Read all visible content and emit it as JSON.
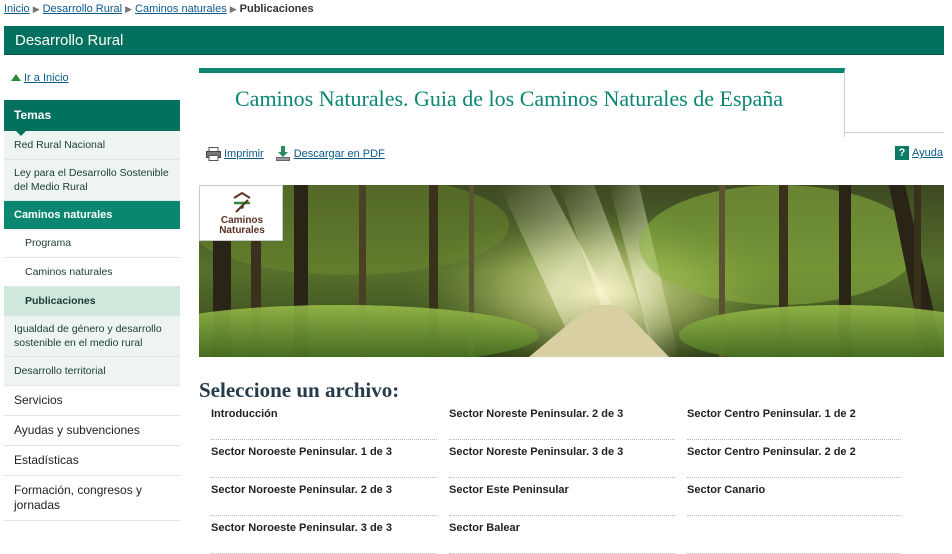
{
  "breadcrumb": {
    "links": [
      "Inicio",
      "Desarrollo Rural",
      "Caminos naturales"
    ],
    "current": "Publicaciones"
  },
  "header": {
    "title": "Desarrollo Rural"
  },
  "home_link": {
    "label": "Ir a Inicio",
    "icon": "up-triangle-icon"
  },
  "sidebar": {
    "heading": "Temas",
    "items": [
      "Red Rural Nacional",
      "Ley para el Desarrollo Sostenible del Medio Rural"
    ],
    "section": "Caminos naturales",
    "sub_items": [
      "Programa",
      "Caminos naturales",
      "Publicaciones"
    ],
    "items_after": [
      "Igualdad de género y desarrollo sostenible en el medio rural",
      "Desarrollo territorial"
    ],
    "main_items": [
      "Servicios",
      "Ayudas y subvenciones",
      "Estadísticas",
      "Formación, congresos y jornadas"
    ]
  },
  "page": {
    "title": "Caminos Naturales. Guia de los Caminos Naturales de España"
  },
  "toolbar": {
    "print_label": "Imprimir",
    "pdf_label": "Descargar en PDF",
    "help_label": "Ayuda",
    "help_glyph": "?"
  },
  "banner": {
    "logo_line1": "Caminos",
    "logo_line2": "Naturales"
  },
  "files": {
    "heading": "Seleccione un archivo:",
    "columns": [
      [
        "Introducción",
        "Sector Noroeste Peninsular. 1 de 3",
        "Sector Noroeste Peninsular. 2 de 3",
        "Sector Noroeste Peninsular. 3 de 3"
      ],
      [
        "Sector Noreste Peninsular. 2 de 3",
        "Sector Noreste Peninsular. 3 de 3",
        "Sector Este Peninsular",
        "Sector Balear"
      ],
      [
        "Sector Centro Peninsular. 1 de 2",
        "Sector Centro Peninsular. 2 de 2",
        "Sector Canario",
        ""
      ]
    ]
  },
  "colors": {
    "brand_green": "#04705f",
    "accent_green": "#0a8671",
    "link_blue": "#0b5a8a"
  }
}
